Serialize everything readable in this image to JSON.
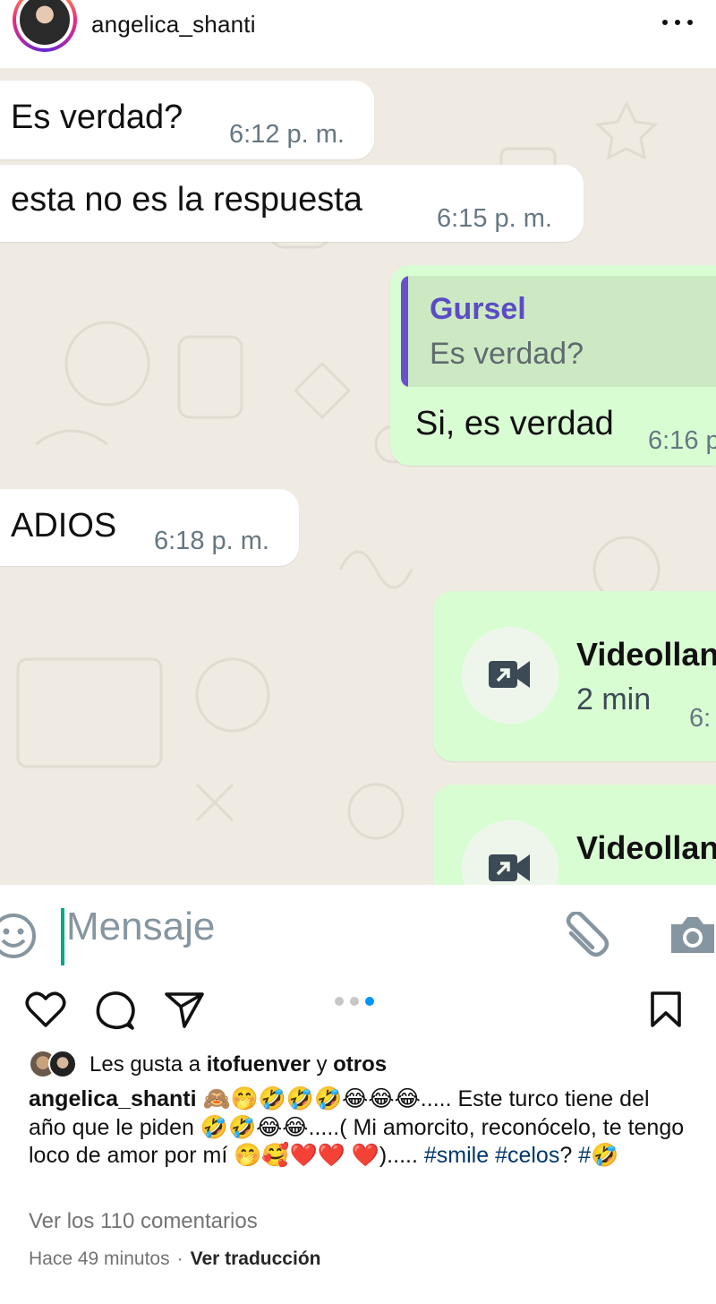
{
  "header": {
    "username": "angelica_shanti",
    "more_icon": "more-horizontal-icon"
  },
  "chat": {
    "messages": [
      {
        "direction": "in",
        "text": "Es verdad?",
        "time": "6:12 p. m."
      },
      {
        "direction": "in",
        "text": "esta no es la respuesta",
        "time": "6:15 p. m."
      },
      {
        "direction": "out",
        "quote_author": "Gursel",
        "quote_text": "Es verdad?",
        "text": "Si, es verdad",
        "time": "6:16 p"
      },
      {
        "direction": "in",
        "text": "ADIOS",
        "time": "6:18 p. m."
      },
      {
        "direction": "out",
        "type": "video-call",
        "title": "Videollan",
        "duration": "2 min",
        "time": "6:"
      },
      {
        "direction": "out",
        "type": "video-call",
        "title": "Videollan"
      }
    ],
    "colors": {
      "background": "#efeae2",
      "incoming": "#ffffff",
      "outgoing": "#d9fdd3",
      "quote_bar": "#6a4fcf",
      "cursor": "#00a884"
    }
  },
  "composer": {
    "placeholder": "Mensaje",
    "icons": [
      "emoji-icon",
      "attach-icon",
      "camera-icon"
    ]
  },
  "post_actions": {
    "icons": [
      "heart-icon",
      "comment-icon",
      "share-icon",
      "bookmark-icon"
    ],
    "carousel": {
      "count": 3,
      "active": 3
    }
  },
  "likes": {
    "prefix": "Les gusta a ",
    "user": "itofuenver",
    "joiner": " y ",
    "others": "otros"
  },
  "caption": {
    "username": "angelica_shanti",
    "line1": "🙈🤭🤣🤣🤣😂😂😂..... Este turco tiene del año que le piden 🤣🤣😂😂.....( Mi amorcito, reconócelo, te tengo loco de amor por mí 🤭🥰❤️❤️ ❤️).....",
    "tags": [
      "#smile",
      "#celos"
    ],
    "after_tags": "? ",
    "last_tag": "#🤣"
  },
  "comments_link": "Ver los 110 comentarios",
  "posted": "Hace 49 minutos",
  "separator": "·",
  "translate": "Ver traducción"
}
